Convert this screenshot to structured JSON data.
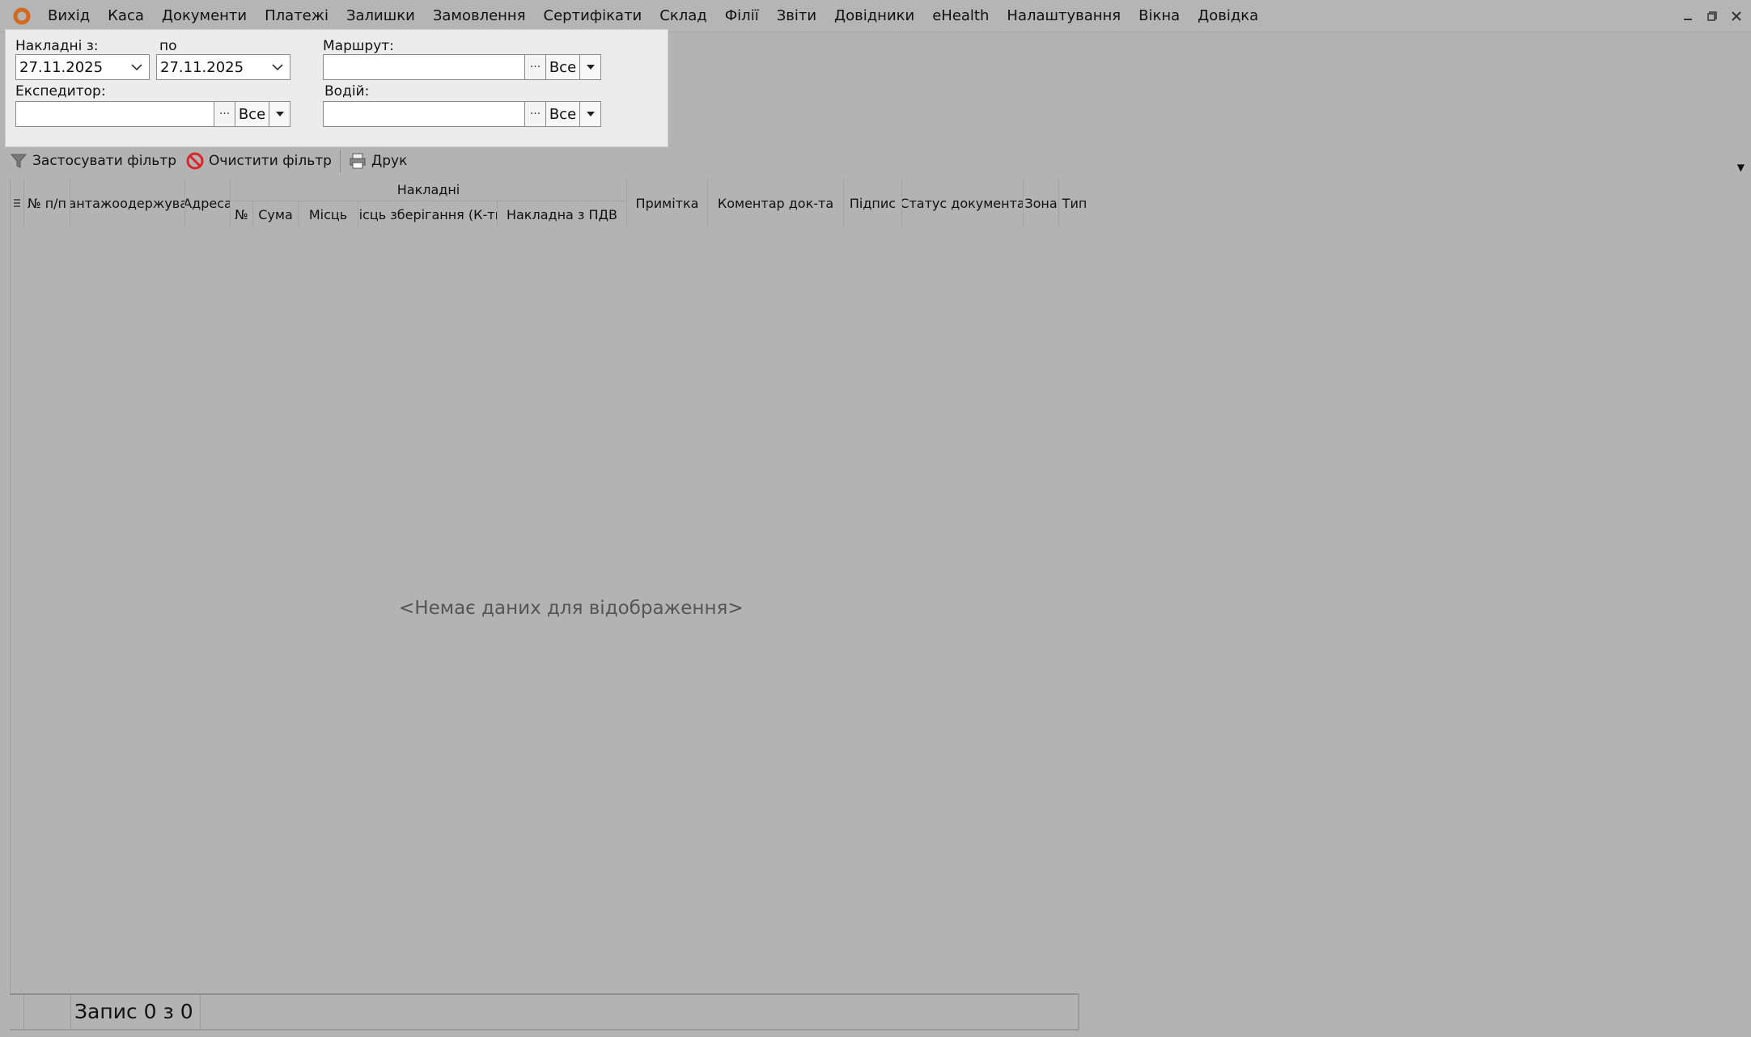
{
  "menu": {
    "items": [
      "Вихід",
      "Каса",
      "Документи",
      "Платежі",
      "Залишки",
      "Замовлення",
      "Сертифікати",
      "Склад",
      "Філії",
      "Звіти",
      "Довідники",
      "eHealth",
      "Налаштування",
      "Вікна",
      "Довідка"
    ]
  },
  "filters": {
    "invoices_from_label": "Накладні з:",
    "invoices_from_value": "27.11.2025",
    "to_label": "по",
    "to_value": "27.11.2025",
    "route_label": "Маршрут:",
    "route_all": "Все",
    "forwarder_label": "Експедитор:",
    "forwarder_all": "Все",
    "driver_label": "Водій:",
    "driver_all": "Все",
    "dots": "···"
  },
  "toolbar": {
    "apply_filter": "Застосувати фільтр",
    "clear_filter": "Очистити фільтр",
    "print": "Друк"
  },
  "grid": {
    "columns": {
      "num": "№ п/п",
      "consignee": "Вантажоодержувач",
      "address": "Адреса",
      "group": "Накладні",
      "doc_no": "№",
      "sum": "Сума",
      "places": "Місць",
      "storage_places": "Місць зберігання (К-ть)",
      "vat_invoice": "Накладна з ПДВ",
      "note": "Примітка",
      "doc_comment": "Коментар док-та",
      "signature": "Підпис",
      "doc_status": "Статус документа",
      "zone": "Зона",
      "type": "Тип"
    },
    "empty_message": "<Немає даних для відображення>"
  },
  "status": {
    "records": "Запис 0 з 0"
  }
}
